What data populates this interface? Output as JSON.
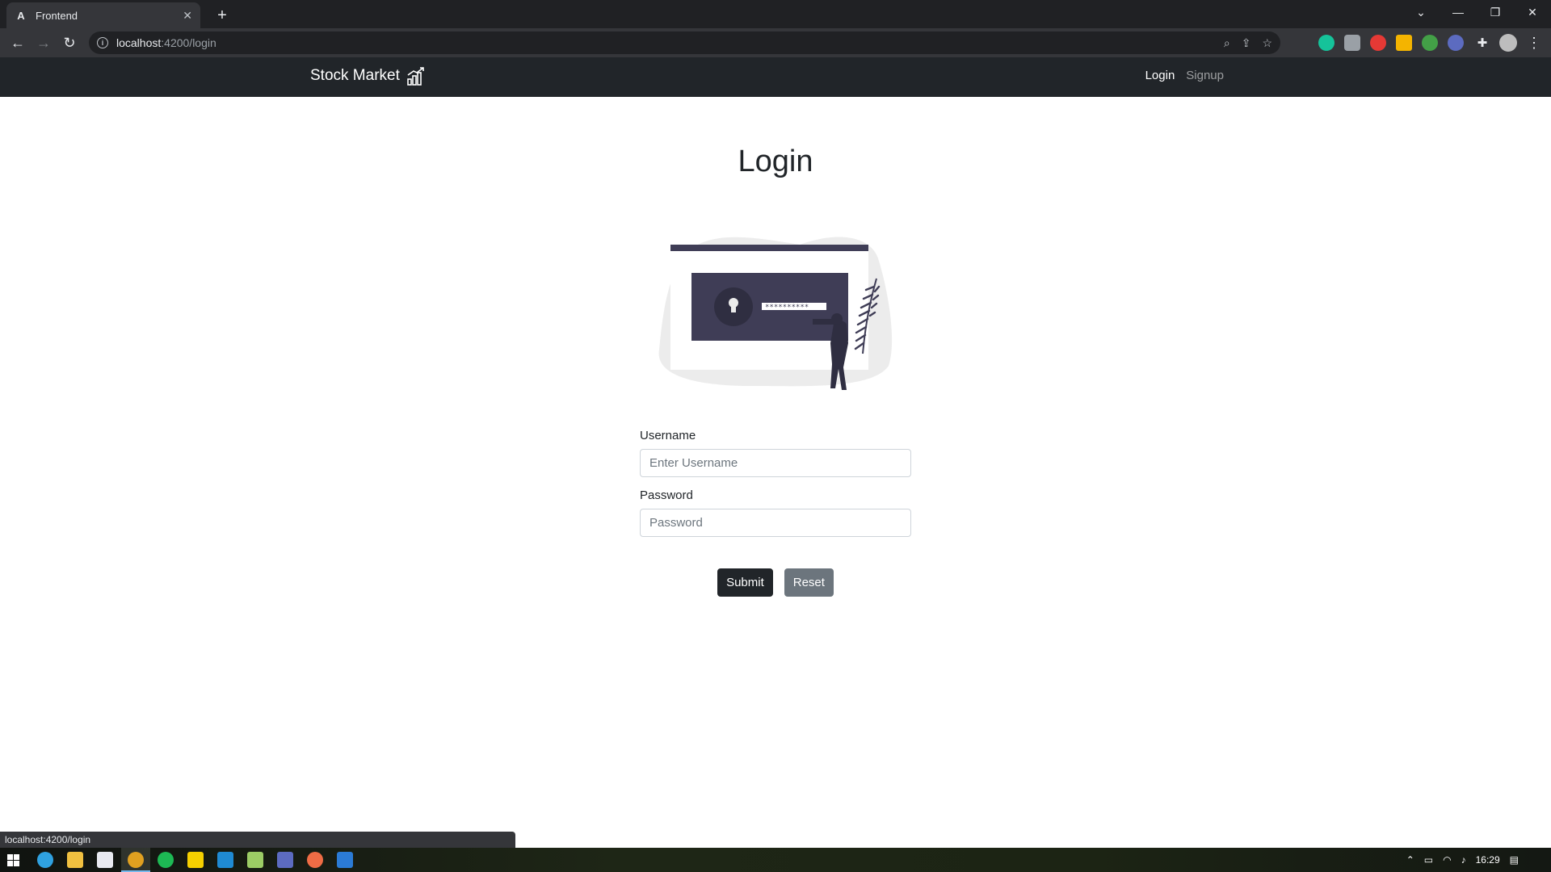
{
  "browser": {
    "tab_title": "Frontend",
    "tab_favicon": "A",
    "url_host": "localhost",
    "url_path": ":4200/login",
    "status_url": "localhost:4200/login"
  },
  "app": {
    "brand": "Stock Market",
    "nav": {
      "login": "Login",
      "signup": "Signup"
    }
  },
  "login": {
    "title": "Login",
    "username_label": "Username",
    "username_placeholder": "Enter Username",
    "password_label": "Password",
    "password_placeholder": "Password",
    "submit_label": "Submit",
    "reset_label": "Reset"
  },
  "taskbar": {
    "time": "16:29"
  },
  "colors": {
    "navbar": "#212529",
    "illustration": "#3f3d56",
    "button_dark": "#212529",
    "button_secondary": "#6c757d"
  }
}
